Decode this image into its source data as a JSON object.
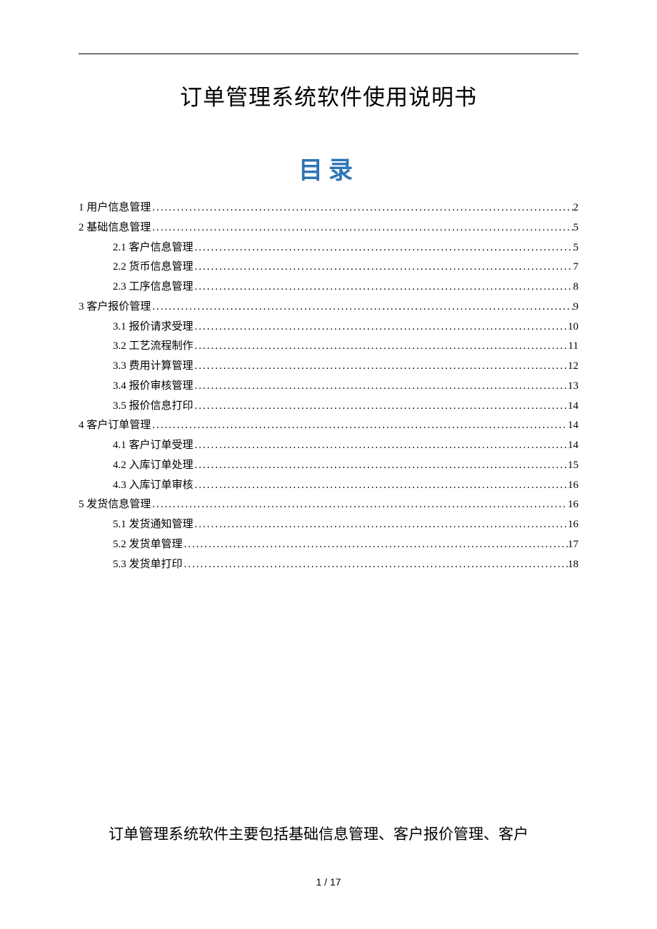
{
  "doc_title": "订单管理系统软件使用说明书",
  "toc_title": "目录",
  "toc": [
    {
      "level": 1,
      "label": "1 用户信息管理",
      "page": "2"
    },
    {
      "level": 1,
      "label": "2 基础信息管理",
      "page": "5"
    },
    {
      "level": 2,
      "label": "2.1 客户信息管理",
      "page": "5"
    },
    {
      "level": 2,
      "label": "2.2 货币信息管理",
      "page": "7"
    },
    {
      "level": 2,
      "label": "2.3 工序信息管理",
      "page": "8"
    },
    {
      "level": 1,
      "label": "3 客户报价管理",
      "page": "9"
    },
    {
      "level": 2,
      "label": "3.1 报价请求受理",
      "page": "10"
    },
    {
      "level": 2,
      "label": "3.2 工艺流程制作",
      "page": "11"
    },
    {
      "level": 2,
      "label": "3.3 费用计算管理",
      "page": "12"
    },
    {
      "level": 2,
      "label": "3.4 报价审核管理",
      "page": "13"
    },
    {
      "level": 2,
      "label": "3.5 报价信息打印",
      "page": "14"
    },
    {
      "level": 1,
      "label": "4 客户订单管理",
      "page": "14"
    },
    {
      "level": 2,
      "label": "4.1 客户订单受理",
      "page": "14"
    },
    {
      "level": 2,
      "label": "4.2 入库订单处理",
      "page": "15"
    },
    {
      "level": 2,
      "label": "4.3 入库订单审核",
      "page": "16"
    },
    {
      "level": 1,
      "label": "5 发货信息管理",
      "page": "16"
    },
    {
      "level": 2,
      "label": "5.1 发货通知管理",
      "page": "16"
    },
    {
      "level": 2,
      "label": "5.2 发货单管理",
      "page": "17"
    },
    {
      "level": 2,
      "label": "5.3 发货单打印",
      "page": "18"
    }
  ],
  "intro_text": "订单管理系统软件主要包括基础信息管理、客户报价管理、客户",
  "footer": "1 / 17"
}
